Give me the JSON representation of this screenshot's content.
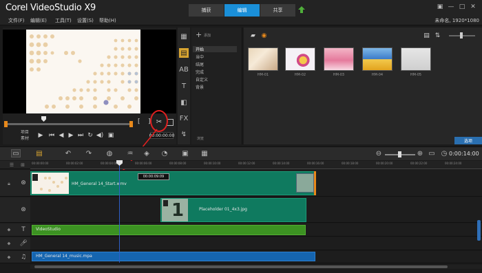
{
  "app": {
    "title_prefix": "Corel",
    "title_main": "VideoStudio X9"
  },
  "stage_tabs": [
    "捕获",
    "编辑",
    "共享"
  ],
  "active_stage": 1,
  "menu": [
    "文件(F)",
    "编辑(E)",
    "工具(T)",
    "设置(S)",
    "帮助(H)"
  ],
  "project_props": "未命名, 1920*1080",
  "player": {
    "mode_label_1": "项目",
    "mode_label_2": "素材",
    "timecode": "00:00:00:00",
    "mark_in": "[",
    "mark_out": "]"
  },
  "library": {
    "add_label": "添加",
    "categories": [
      "开始",
      "当中",
      "结尾",
      "完成",
      "自定义",
      "背景"
    ],
    "selected_category": 0,
    "browse_label": "浏览",
    "thumb_labels": [
      "HM-01",
      "HM-02",
      "HM-03",
      "HM-04",
      "HM-05"
    ],
    "options_label": "选项"
  },
  "timeline": {
    "timecode": "0:00:14:00",
    "ruler": [
      "00:00:00:00",
      "00:00:02:00",
      "00:00:04:00",
      "00:00:06:00",
      "00:00:08:00",
      "00:00:10:00",
      "00:00:12:00",
      "00:00:14:00",
      "00:00:16:00",
      "00:00:18:00",
      "00:00:20:00",
      "00:00:22:00",
      "00:00:24:00"
    ],
    "tooltip_tc": "00:00:09:09",
    "clips": {
      "video": "HM_General 14_Start.wmv",
      "overlay": "Placeholder 01_4x3.jpg",
      "title": "VideoStudio",
      "music": "HM_General 14_music.mpa"
    },
    "placeholder_number": "1"
  },
  "colors": {
    "accent": "#1a8fd8",
    "video_clip": "#0f7a5f",
    "title_clip": "#3c9222",
    "music_clip": "#1565b0",
    "highlight_circle": "#e02020"
  }
}
